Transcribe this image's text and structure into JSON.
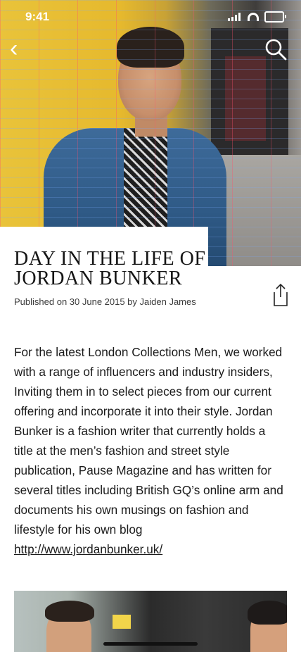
{
  "status_bar": {
    "time": "9:41"
  },
  "article": {
    "title": "DAY IN THE LIFE OF JORDAN BUNKER",
    "byline": "Published on 30 June 2015 by Jaiden James",
    "body_text": "For the latest London Collections Men, we worked with a range of influencers and industry insiders, Inviting them in to select pieces from our current offering and incorporate it into their style. Jordan Bunker is a fashion writer that currently holds a title at the men’s fashion and street style publication, Pause Magazine and has written for several titles including British GQ’s online arm and documents his own musings on fashion and lifestyle for his own blog ",
    "link_text": "http://www.jordanbunker.uk/"
  },
  "icons": {
    "back": "chevron-left-icon",
    "search": "search-icon",
    "share": "share-icon"
  },
  "colors": {
    "text": "#1a1a1a",
    "background": "#ffffff",
    "hero_yellow": "#e6b92d"
  }
}
